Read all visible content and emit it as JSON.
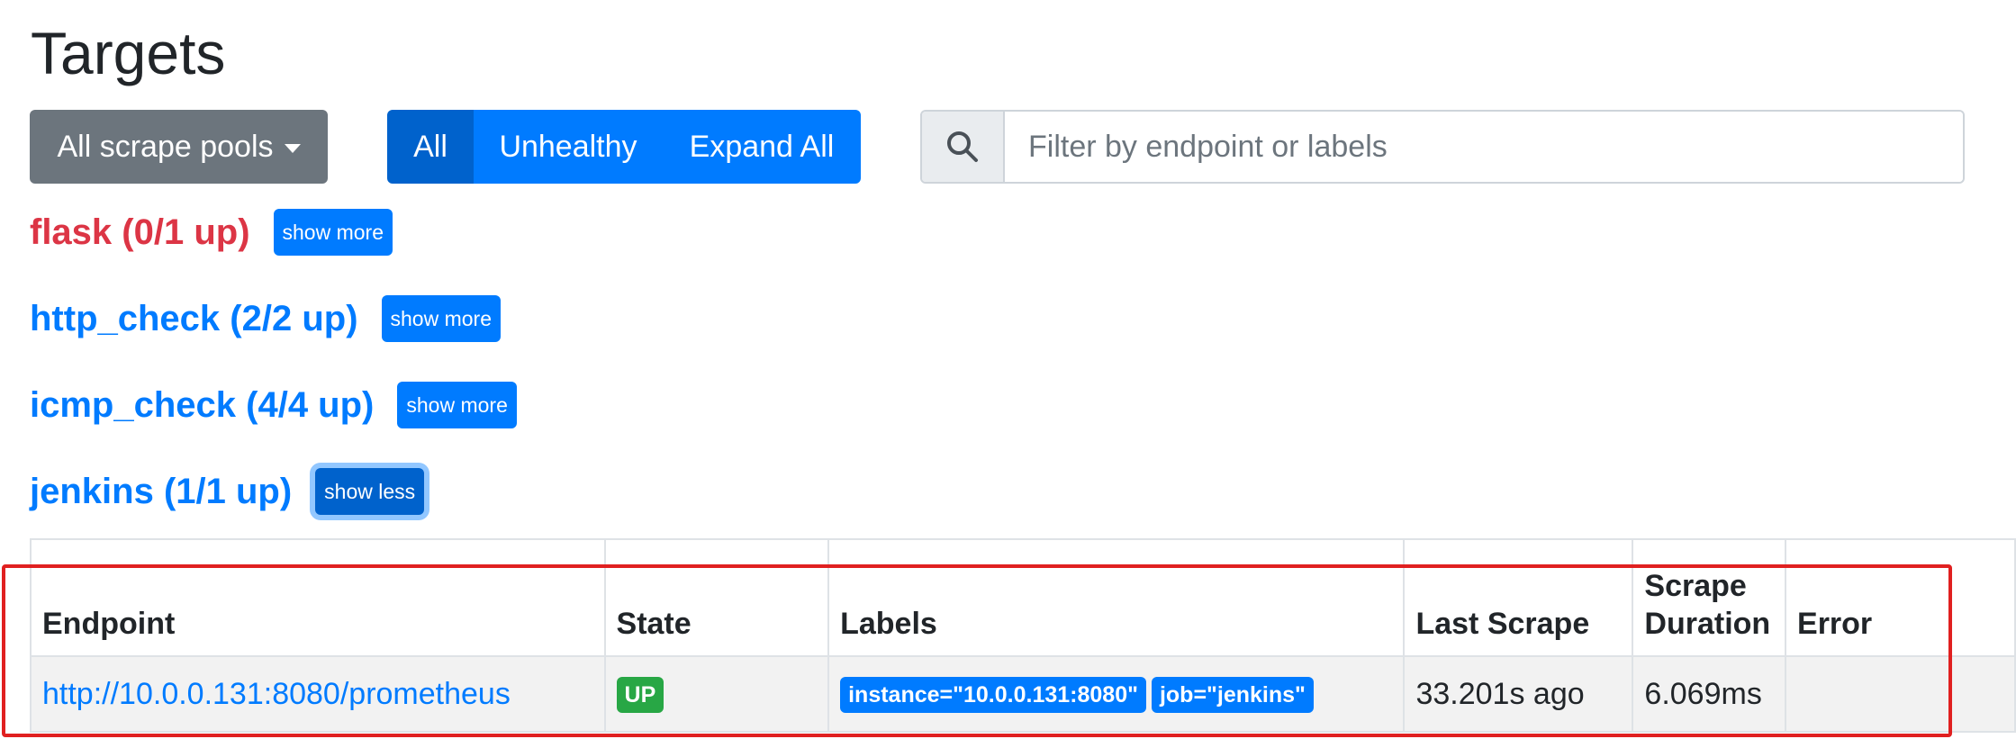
{
  "page": {
    "title": "Targets"
  },
  "toolbar": {
    "pools_label": "All scrape pools",
    "all_label": "All",
    "unhealthy_label": "Unhealthy",
    "expand_label": "Expand All",
    "search_placeholder": "Filter by endpoint or labels"
  },
  "pools": [
    {
      "title": "flask (0/1 up)",
      "toggle": "show more",
      "status": "danger"
    },
    {
      "title": "http_check (2/2 up)",
      "toggle": "show more",
      "status": "healthy"
    },
    {
      "title": "icmp_check (4/4 up)",
      "toggle": "show more",
      "status": "healthy"
    },
    {
      "title": "jenkins (1/1 up)",
      "toggle": "show less",
      "status": "healthy"
    }
  ],
  "table": {
    "headers": {
      "endpoint": "Endpoint",
      "state": "State",
      "labels": "Labels",
      "last_scrape": "Last Scrape",
      "scrape_duration": "Scrape Duration",
      "error": "Error"
    },
    "rows": [
      {
        "endpoint": "http://10.0.0.131:8080/prometheus",
        "state": "UP",
        "labels": [
          "instance=\"10.0.0.131:8080\"",
          "job=\"jenkins\""
        ],
        "last_scrape": "33.201s ago",
        "scrape_duration": "6.069ms",
        "error": ""
      }
    ]
  },
  "colors": {
    "primary": "#007bff",
    "danger": "#dc3545",
    "success": "#28a745",
    "secondary": "#6c757d",
    "highlight": "#e02020"
  },
  "icons": {
    "search": "search-icon",
    "dropdown": "caret-down-icon"
  }
}
